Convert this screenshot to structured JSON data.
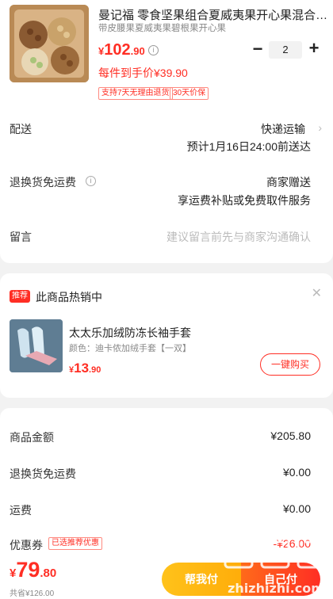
{
  "product": {
    "title": "曼记福 零食坚果组合夏威夷果开心果混合坚果",
    "subtitle": "带皮腰果夏威夷果碧根果开心果",
    "price_currency": "¥",
    "price_int": "102",
    "price_dec": ".90",
    "quantity": "2",
    "unit_price": "每件到手价¥39.90",
    "tags": [
      "支持7天无理由退货",
      "30天价保"
    ]
  },
  "delivery": {
    "label": "配送",
    "method": "快递运输",
    "eta": "预计1月16日24:00前送达"
  },
  "return_shipping": {
    "label": "退换货免运费",
    "value": "商家赠送",
    "desc": "享运费补贴或免费取件服务"
  },
  "message": {
    "label": "留言",
    "placeholder": "建议留言前先与商家沟通确认"
  },
  "recommend": {
    "badge": "推荐",
    "title": "此商品热销中",
    "name": "太太乐加绒防冻长袖手套",
    "spec": "颜色：迪卡侬加绒手套【一双】",
    "price_currency": "¥",
    "price_int": "13",
    "price_dec": ".90",
    "buy_label": "一键购买"
  },
  "summary": {
    "goods_label": "商品金额",
    "goods_value": "¥205.80",
    "return_label": "退换货免运费",
    "return_value": "¥0.00",
    "shipping_label": "运费",
    "shipping_value": "¥0.00",
    "coupon_label": "优惠券",
    "coupon_tag": "已选推荐优惠",
    "coupon_value": "-¥26.00"
  },
  "bottom": {
    "total_currency": "¥",
    "total_int": "79",
    "total_dec": ".80",
    "saved": "共省¥126.00",
    "help_pay": "帮我付",
    "self_pay": "自己付"
  },
  "watermark": "值 什么值得买 zhizhizhi.com",
  "colors": {
    "accent": "#ff2e24",
    "help_button": "#ffb812",
    "background": "#f2f2f2"
  }
}
